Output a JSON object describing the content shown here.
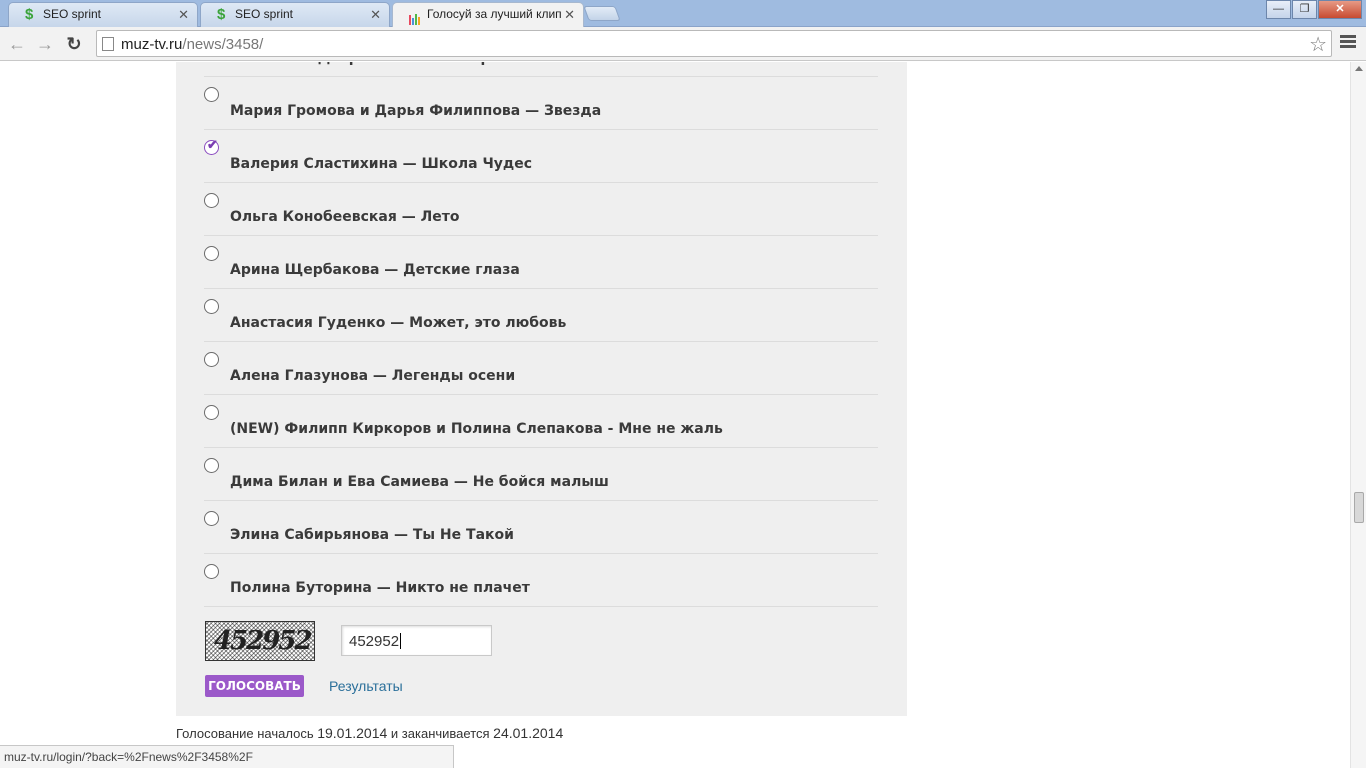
{
  "browser": {
    "tabs": [
      {
        "title": "SEO sprint",
        "favicon": "seo-sprint-icon"
      },
      {
        "title": "SEO sprint",
        "favicon": "seo-sprint-icon"
      },
      {
        "title": "Голосуй за лучший клип",
        "favicon": "muz-tv-icon"
      }
    ],
    "url": {
      "host": "muz-tv.ru",
      "path": "/news/3458/"
    },
    "status_url": "muz-tv.ru/login/?back=%2Fnews%2F3458%2F"
  },
  "poll": {
    "options": [
      {
        "label": "Анастасия Дворянская — Так просто",
        "checked": false
      },
      {
        "label": "Мария Громова и Дарья Филиппова — Звезда",
        "checked": false
      },
      {
        "label": "Валерия Сластихина — Школа Чудес",
        "checked": true
      },
      {
        "label": "Ольга Конобеевская — Лето",
        "checked": false
      },
      {
        "label": "Арина Щербакова — Детские глаза",
        "checked": false
      },
      {
        "label": "Анастасия Гуденко — Может, это любовь",
        "checked": false
      },
      {
        "label": "Алена Глазунова — Легенды осени",
        "checked": false
      },
      {
        "label": "(NEW) Филипп Киркоров и Полина Слепакова - Мне не жаль",
        "checked": false
      },
      {
        "label": "Дима Билан и Ева Самиева — Не бойся малыш",
        "checked": false
      },
      {
        "label": "Элина Сабирьянова — Ты Не Такой",
        "checked": false
      },
      {
        "label": "Полина Буторина — Никто не плачет",
        "checked": false
      }
    ],
    "captcha_image_text": "452952",
    "captcha_input_value": "452952",
    "vote_button": "ГОЛОСОВАТЬ",
    "results_link": "Результаты",
    "dates": {
      "prefix": "Голосование началось",
      "start": "19.01.2014",
      "middle": "и заканчивается",
      "end": "24.01.2014"
    }
  },
  "colors": {
    "accent": "#9b59c9",
    "link": "#2a6f9a",
    "panel": "#efefef"
  }
}
